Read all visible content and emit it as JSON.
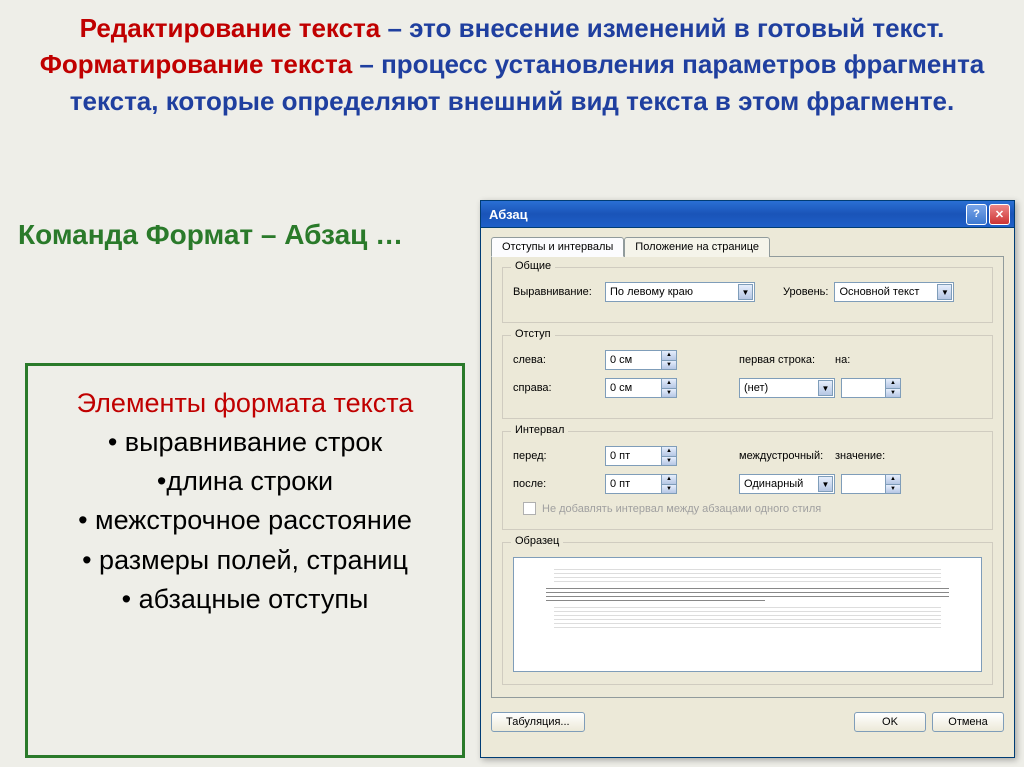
{
  "header": {
    "term_edit": "Редактирование текста",
    "desc_edit": " – это внесение изменений в готовый текст.",
    "term_format": "Форматирование текста",
    "desc_format": " – процесс установления параметров фрагмента текста, которые определяют внешний вид текста в этом фрагменте."
  },
  "command_line": "Команда Формат – Абзац …",
  "elements": {
    "title": "Элементы формата текста",
    "items": [
      "выравнивание строк",
      "длина строки",
      "межстрочное расстояние",
      "размеры полей, страниц",
      "абзацные отступы"
    ]
  },
  "dialog": {
    "title": "Абзац",
    "tabs": {
      "active": "Отступы и интервалы",
      "other": "Положение на странице"
    },
    "general": {
      "group": "Общие",
      "align_label": "Выравнивание:",
      "align_value": "По левому краю",
      "level_label": "Уровень:",
      "level_value": "Основной текст"
    },
    "indent": {
      "group": "Отступ",
      "left_label": "слева:",
      "left_value": "0 см",
      "right_label": "справа:",
      "right_value": "0 см",
      "first_line_label": "первая строка:",
      "first_line_value": "(нет)",
      "by_label": "на:",
      "by_value": ""
    },
    "spacing": {
      "group": "Интервал",
      "before_label": "перед:",
      "before_value": "0 пт",
      "after_label": "после:",
      "after_value": "0 пт",
      "line_label": "междустрочный:",
      "line_value": "Одинарный",
      "at_label": "значение:",
      "at_value": "",
      "checkbox": "Не добавлять интервал между абзацами одного стиля"
    },
    "preview": {
      "group": "Образец"
    },
    "buttons": {
      "tabs": "Табуляция...",
      "ok": "OK",
      "cancel": "Отмена"
    }
  }
}
